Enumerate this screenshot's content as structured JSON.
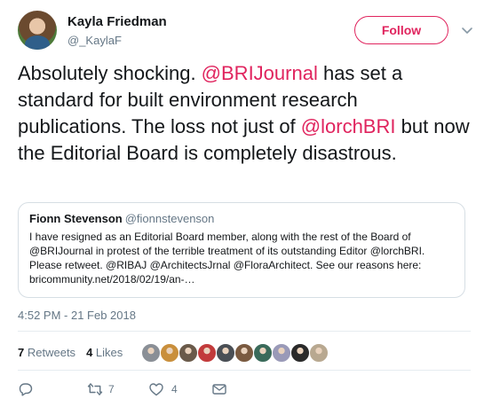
{
  "author": {
    "name": "Kayla Friedman",
    "handle": "@_KaylaF"
  },
  "follow_label": "Follow",
  "tweet": {
    "parts": [
      {
        "text": "Absolutely shocking. ",
        "mention": false
      },
      {
        "text": "@BRIJournal",
        "mention": true
      },
      {
        "text": " has set a standard for built environment research publications.  The loss not just of ",
        "mention": false
      },
      {
        "text": "@lorchBRI",
        "mention": true
      },
      {
        "text": " but now the Editorial Board is completely disastrous.",
        "mention": false
      }
    ]
  },
  "quoted": {
    "name": "Fionn Stevenson",
    "handle": "@fionnstevenson",
    "text": "I have resigned as an Editorial Board member, along with the rest of the Board of @BRIJournal in protest of the terrible treatment of its outstanding Editor @lorchBRI. Please retweet.  @RIBAJ @ArchitectsJrnal @FloraArchitect. See our reasons here: bricommunity.net/2018/02/19/an-…"
  },
  "timestamp": "4:52 PM - 21 Feb 2018",
  "stats": {
    "retweets_count": "7",
    "retweets_label": "Retweets",
    "likes_count": "4",
    "likes_label": "Likes"
  },
  "likers": [
    {
      "color": "#8a8f96"
    },
    {
      "color": "#c98f3c"
    },
    {
      "color": "#6a5a4a"
    },
    {
      "color": "#c23b3b"
    },
    {
      "color": "#4a4f55"
    },
    {
      "color": "#7a5a40"
    },
    {
      "color": "#3a6a5a"
    },
    {
      "color": "#9a9ab8"
    },
    {
      "color": "#2a2a2a"
    },
    {
      "color": "#b8a890"
    }
  ],
  "actions": {
    "reply_count": "",
    "retweet_count": "7",
    "like_count": "4"
  },
  "colors": {
    "accent": "#e0245e",
    "muted": "#657786",
    "text": "#14171a",
    "border": "#e6ecf0"
  }
}
